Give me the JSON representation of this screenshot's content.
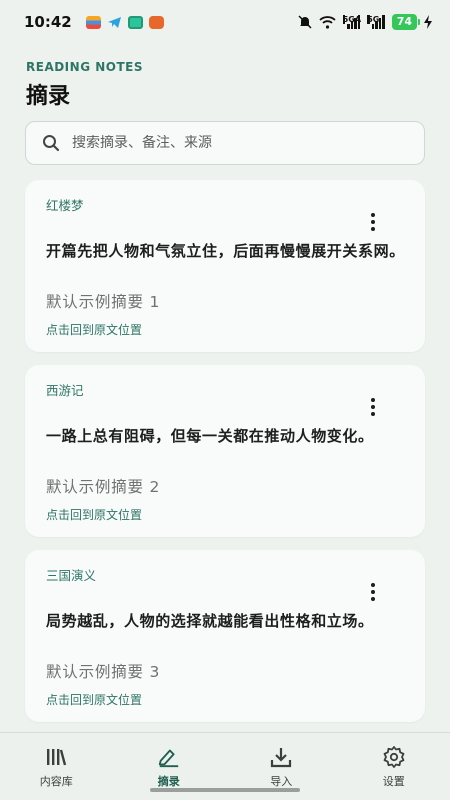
{
  "status_bar": {
    "time": "10:42",
    "signal1_label": "5GA",
    "signal2_label": "5G",
    "battery": "74",
    "notification_icons": [
      "stack-app-icon",
      "telegram-icon",
      "robot-app-icon",
      "cat-app-icon"
    ],
    "colors": {
      "battery": "#35c759"
    }
  },
  "header": {
    "overline": "READING NOTES",
    "title": "摘录"
  },
  "search": {
    "placeholder": "搜索摘录、备注、来源",
    "value": ""
  },
  "cards": [
    {
      "source": "红楼梦",
      "quote": "开篇先把人物和气氛立住，后面再慢慢展开关系网。",
      "note": "默认示例摘要 1",
      "link": "点击回到原文位置"
    },
    {
      "source": "西游记",
      "quote": "一路上总有阻碍，但每一关都在推动人物变化。",
      "note": "默认示例摘要 2",
      "link": "点击回到原文位置"
    },
    {
      "source": "三国演义",
      "quote": "局势越乱，人物的选择就越能看出性格和立场。",
      "note": "默认示例摘要 3",
      "link": "点击回到原文位置"
    }
  ],
  "bottom_nav": {
    "items": [
      {
        "label": "内容库",
        "icon": "library-icon"
      },
      {
        "label": "摘录",
        "icon": "highlight-pen-icon",
        "active": true
      },
      {
        "label": "导入",
        "icon": "download-icon"
      },
      {
        "label": "设置",
        "icon": "gear-icon"
      }
    ]
  },
  "colors": {
    "accent": "#2e7565",
    "background": "#eef2ef",
    "card": "#f9fbfa"
  }
}
